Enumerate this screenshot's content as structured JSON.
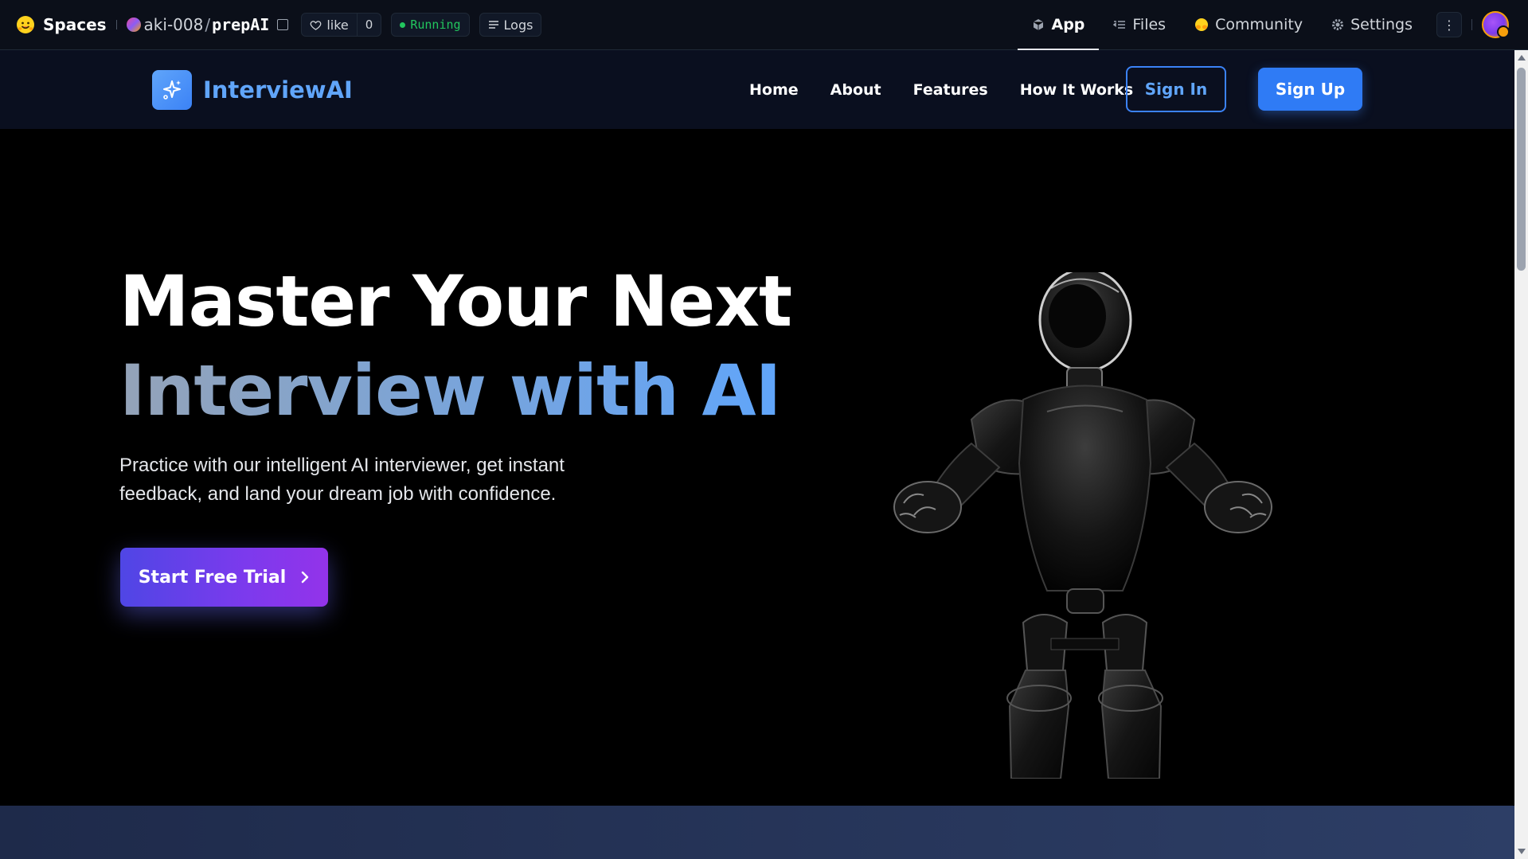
{
  "hf": {
    "spaces_label": "Spaces",
    "owner": "aki-008",
    "slash": "/",
    "repo": "prepAI",
    "like_label": "like",
    "like_count": "0",
    "status": "Running",
    "logs_label": "Logs",
    "tabs": [
      {
        "label": "App",
        "icon": "cube-icon",
        "active": true
      },
      {
        "label": "Files",
        "icon": "files-icon",
        "active": false
      },
      {
        "label": "Community",
        "icon": "community-icon",
        "active": false
      },
      {
        "label": "Settings",
        "icon": "gear-icon",
        "active": false
      }
    ],
    "more_label": "⋮"
  },
  "site": {
    "brand": "InterviewAI",
    "nav": [
      "Home",
      "About",
      "Features",
      "How It Works"
    ],
    "signin": "Sign In",
    "signup": "Sign Up"
  },
  "hero": {
    "title_line1": "Master Your Next",
    "title_line2": "Interview with AI",
    "description": "Practice with our intelligent AI interviewer, get instant feedback, and land your dream job with confidence.",
    "cta": "Start Free Trial"
  },
  "colors": {
    "accent": "#3b82f6",
    "status_green": "#22c55e",
    "cta_start": "#4f46e5",
    "cta_end": "#9333ea"
  }
}
